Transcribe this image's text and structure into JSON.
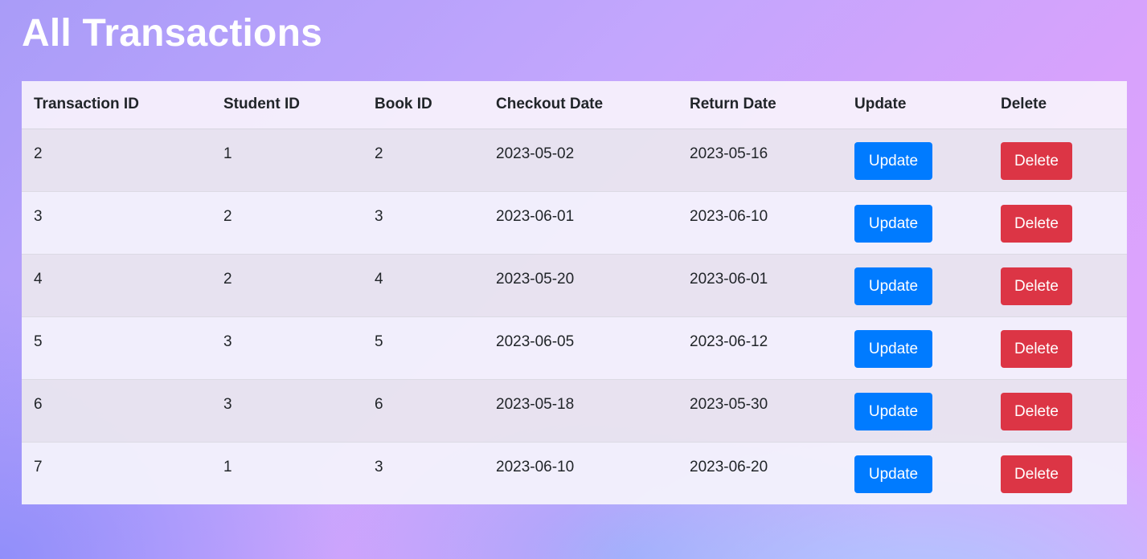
{
  "page": {
    "title": "All Transactions"
  },
  "table": {
    "headers": [
      "Transaction ID",
      "Student ID",
      "Book ID",
      "Checkout Date",
      "Return Date",
      "Update",
      "Delete"
    ],
    "rows": [
      {
        "transaction_id": "2",
        "student_id": "1",
        "book_id": "2",
        "checkout_date": "2023-05-02",
        "return_date": "2023-05-16",
        "update_label": "Update",
        "delete_label": "Delete"
      },
      {
        "transaction_id": "3",
        "student_id": "2",
        "book_id": "3",
        "checkout_date": "2023-06-01",
        "return_date": "2023-06-10",
        "update_label": "Update",
        "delete_label": "Delete"
      },
      {
        "transaction_id": "4",
        "student_id": "2",
        "book_id": "4",
        "checkout_date": "2023-05-20",
        "return_date": "2023-06-01",
        "update_label": "Update",
        "delete_label": "Delete"
      },
      {
        "transaction_id": "5",
        "student_id": "3",
        "book_id": "5",
        "checkout_date": "2023-06-05",
        "return_date": "2023-06-12",
        "update_label": "Update",
        "delete_label": "Delete"
      },
      {
        "transaction_id": "6",
        "student_id": "3",
        "book_id": "6",
        "checkout_date": "2023-05-18",
        "return_date": "2023-05-30",
        "update_label": "Update",
        "delete_label": "Delete"
      },
      {
        "transaction_id": "7",
        "student_id": "1",
        "book_id": "3",
        "checkout_date": "2023-06-10",
        "return_date": "2023-06-20",
        "update_label": "Update",
        "delete_label": "Delete"
      }
    ]
  },
  "colors": {
    "update_button": "#007bff",
    "delete_button": "#dc3545",
    "title_text": "#ffffff"
  }
}
